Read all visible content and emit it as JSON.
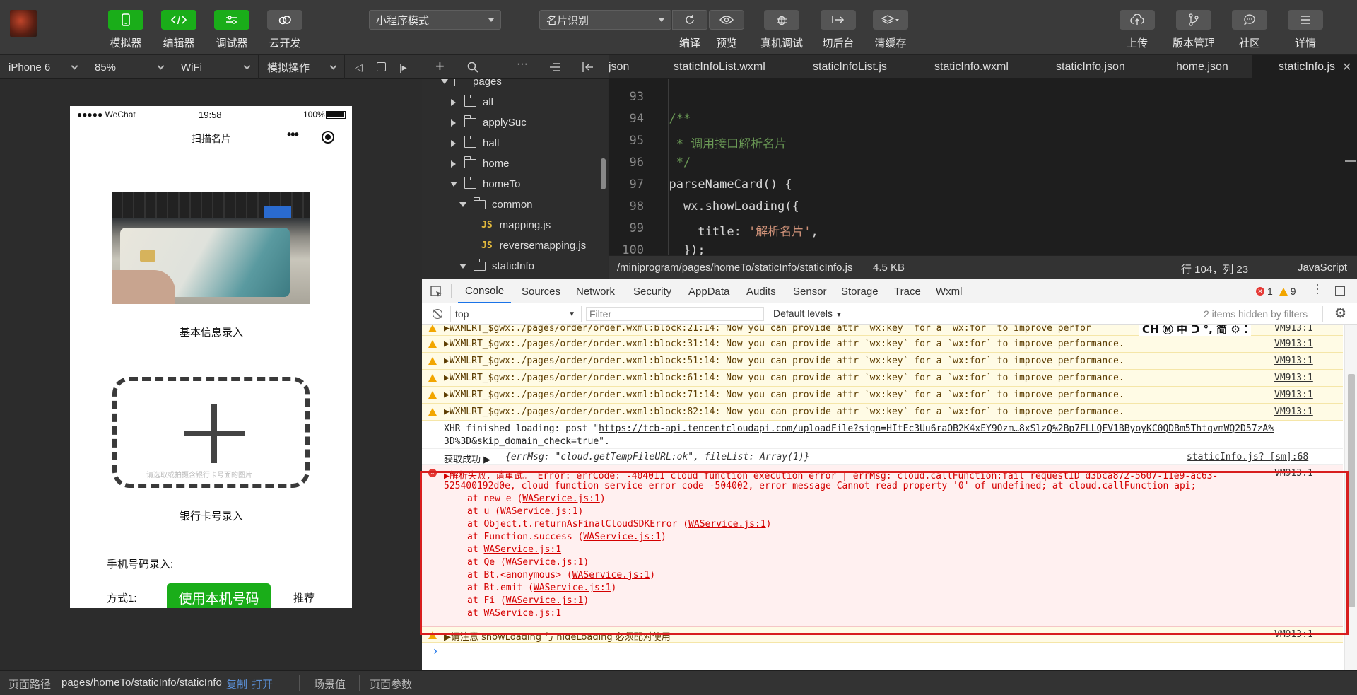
{
  "toolbar": {
    "simulator": "模拟器",
    "editor": "编辑器",
    "debugger": "调试器",
    "cloud": "云开发",
    "mode_select": "小程序模式",
    "compile_select": "名片识别",
    "compile": "编译",
    "preview": "预览",
    "remote_debug": "真机调试",
    "background": "切后台",
    "clear_cache": "清缓存",
    "upload": "上传",
    "version": "版本管理",
    "community": "社区",
    "details": "详情"
  },
  "device_bar": {
    "device": "iPhone 6",
    "zoom": "85%",
    "network": "WiFi",
    "operation": "模拟操作"
  },
  "phone": {
    "carrier": "●●●●● WeChat",
    "time": "19:58",
    "battery": "100%",
    "title": "扫描名片",
    "basic_info": "基本信息录入",
    "upload_hint": "请选取或拍摄含银行卡号面的图片",
    "bank_card": "银行卡号录入",
    "phone_label": "手机号码录入:",
    "method_label": "方式1:",
    "use_phone_button": "使用本机号码",
    "recommend": "推荐"
  },
  "tree": {
    "items": [
      {
        "label": "pages"
      },
      {
        "label": "all"
      },
      {
        "label": "applySuc"
      },
      {
        "label": "hall"
      },
      {
        "label": "home"
      },
      {
        "label": "homeTo"
      },
      {
        "label": "common"
      },
      {
        "label": "mapping.js"
      },
      {
        "label": "reversemapping.js"
      },
      {
        "label": "staticInfo"
      }
    ],
    "js_badge": "JS"
  },
  "tabs": [
    {
      "label": "json"
    },
    {
      "label": "staticInfoList.wxml"
    },
    {
      "label": "staticInfoList.js"
    },
    {
      "label": "staticInfo.wxml"
    },
    {
      "label": "staticInfo.json"
    },
    {
      "label": "home.json"
    },
    {
      "label": "staticInfo.js"
    }
  ],
  "editor": {
    "line_numbers": [
      "93",
      "94",
      "95",
      "96",
      "97",
      "98",
      "99",
      "100"
    ],
    "lines": [
      "",
      "  /**",
      "   * 调用接口解析名片",
      "   */",
      "  parseNameCard() {",
      "    wx.showLoading({",
      "      title: '解析名片',",
      "    });"
    ],
    "string_literal": "'解析名片'"
  },
  "status": {
    "path": "/miniprogram/pages/homeTo/staticInfo/staticInfo.js",
    "size": "4.5 KB",
    "position": "行 104，列 23",
    "language": "JavaScript"
  },
  "devtools": {
    "tabs": [
      "Console",
      "Sources",
      "Network",
      "Security",
      "AppData",
      "Audits",
      "Sensor",
      "Storage",
      "Trace",
      "Wxml"
    ],
    "error_count": "1",
    "warn_count": "9",
    "context": "top",
    "filter_placeholder": "Filter",
    "levels": "Default levels",
    "hidden_note": "2 items hidden by filters",
    "ime_glyphs": "CH Ⓜ 中 ᑐ °, 简 ⚙ ⁚"
  },
  "console": {
    "warnings": [
      {
        "text": "▶WXMLRT_$gwx:./pages/order/order.wxml:block:21:14: Now you can provide attr `wx:key` for a `wx:for` to improve perfor",
        "src": "VM913:1"
      },
      {
        "text": "▶WXMLRT_$gwx:./pages/order/order.wxml:block:31:14: Now you can provide attr `wx:key` for a `wx:for` to improve performance.",
        "src": "VM913:1"
      },
      {
        "text": "▶WXMLRT_$gwx:./pages/order/order.wxml:block:51:14: Now you can provide attr `wx:key` for a `wx:for` to improve performance.",
        "src": "VM913:1"
      },
      {
        "text": "▶WXMLRT_$gwx:./pages/order/order.wxml:block:61:14: Now you can provide attr `wx:key` for a `wx:for` to improve performance.",
        "src": "VM913:1"
      },
      {
        "text": "▶WXMLRT_$gwx:./pages/order/order.wxml:block:71:14: Now you can provide attr `wx:key` for a `wx:for` to improve performance.",
        "src": "VM913:1"
      },
      {
        "text": "▶WXMLRT_$gwx:./pages/order/order.wxml:block:82:14: Now you can provide attr `wx:key` for a `wx:for` to improve performance.",
        "src": "VM913:1"
      }
    ],
    "xhr_prefix": "XHR finished loading: post \"",
    "xhr_url1": "https://tcb-api.tencentcloudapi.com/uploadFile?sign=HItEc3Uu6raOB2K4xEY9Ozm…8xSlzQ%2Bp7FLLQFV1BByoyKC0QDBm5ThtqvmWQ2D57zA%",
    "xhr_url2": "3D%3D&skip_domain_check=true",
    "xhr_suffix": "\".",
    "success_label": "获取成功 ▶",
    "success_obj": "{errMsg: \"cloud.getTempFileURL:ok\", fileList: Array(1)}",
    "success_src": "staticInfo.js? [sm]:68",
    "error_head": "▶解析失败，请重试。 Error: errCode: -404011 cloud function execution error | errMsg: cloud.callFunction:fail requestID d3bca872-5607-11e9-ac63-",
    "error_line2": "525400192d0e, cloud function service error code -504002, error message Cannot read property '0' of undefined; at cloud.callFunction api;",
    "error_src": "VM913:1",
    "stack": [
      {
        "pre": "at new e (",
        "link": "WAService.js:1",
        "post": ")"
      },
      {
        "pre": "at u (",
        "link": "WAService.js:1",
        "post": ")"
      },
      {
        "pre": "at Object.t.returnAsFinalCloudSDKError (",
        "link": "WAService.js:1",
        "post": ")"
      },
      {
        "pre": "at Function.success (",
        "link": "WAService.js:1",
        "post": ")"
      },
      {
        "pre": "at ",
        "link": "WAService.js:1",
        "post": ""
      },
      {
        "pre": "at Qe (",
        "link": "WAService.js:1",
        "post": ")"
      },
      {
        "pre": "at Bt.<anonymous> (",
        "link": "WAService.js:1",
        "post": ")"
      },
      {
        "pre": "at Bt.emit (",
        "link": "WAService.js:1",
        "post": ")"
      },
      {
        "pre": "at Fi (",
        "link": "WAService.js:1",
        "post": ")"
      },
      {
        "pre": "at ",
        "link": "WAService.js:1",
        "post": ""
      }
    ],
    "last_warn": "▶请注意 showLoading 与 hideLoading 必须配对使用",
    "last_warn_src": "VM913:1",
    "prompt": "›"
  },
  "bottom": {
    "path_label": "页面路径",
    "path": "pages/homeTo/staticInfo/staticInfo",
    "copy": "复制",
    "open": "打开",
    "scene": "场景值",
    "params": "页面参数"
  },
  "colors": {
    "accent_green": "#1aad19",
    "error_red": "#d40000",
    "highlight_box": "#d81e1e",
    "warning_bg": "#fffbe5"
  }
}
